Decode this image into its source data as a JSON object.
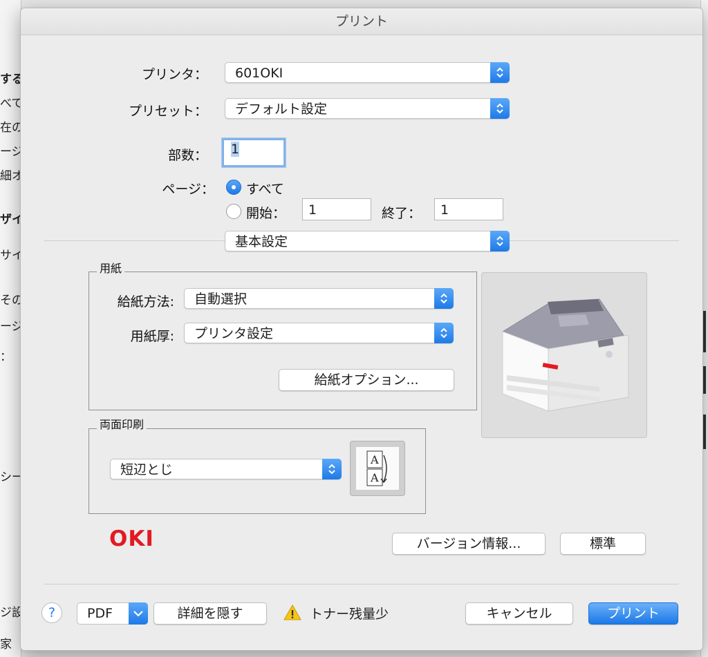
{
  "dialog": {
    "title": "プリント"
  },
  "printer": {
    "label": "プリンタ：",
    "value": "601OKI"
  },
  "preset": {
    "label": "プリセット：",
    "value": "デフォルト設定"
  },
  "copies": {
    "label": "部数：",
    "value": "1"
  },
  "pages": {
    "label": "ページ：",
    "all_label": "すべて",
    "from_label": "開始：",
    "from_value": "1",
    "to_label": "終了：",
    "to_value": "1",
    "selected": "all"
  },
  "panel_select": {
    "value": "基本設定"
  },
  "paper_group": {
    "title": "用紙",
    "source_label": "給紙方法:",
    "source_value": "自動選択",
    "thickness_label": "用紙厚:",
    "thickness_value": "プリンタ設定",
    "options_button": "給紙オプション..."
  },
  "duplex_group": {
    "title": "両面印刷",
    "value": "短辺とじ",
    "icon_letter": "A"
  },
  "brand": {
    "logo_text": "OKI",
    "color": "#e21a22"
  },
  "buttons": {
    "version_info": "バージョン情報...",
    "defaults": "標準",
    "help": "?",
    "pdf": "PDF",
    "hide_details": "詳細を隠す",
    "cancel": "キャンセル",
    "print": "プリント"
  },
  "status": {
    "text": "トナー残量少",
    "icon": "warning-icon"
  },
  "background_fragments": [
    "するペ",
    "べて",
    "在の",
    "ージ",
    "細オ",
    "ザイ",
    "サイ",
    "その印",
    "ージ",
    "：",
    "シー",
    "ジ設",
    "家"
  ],
  "colors": {
    "accent": "#1e7ae8",
    "sheet": "#ececec"
  }
}
